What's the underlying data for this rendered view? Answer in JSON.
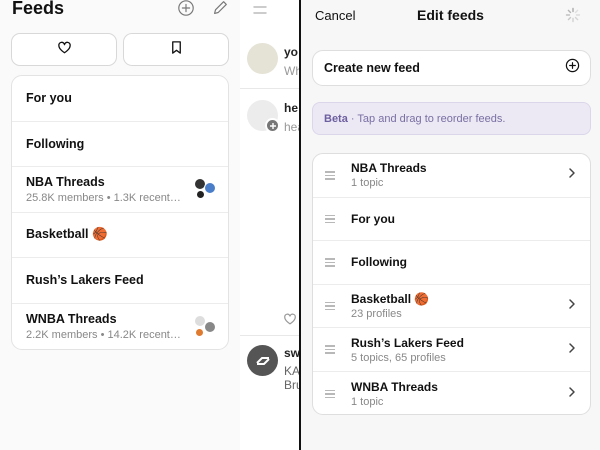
{
  "feeds_panel": {
    "title": "Feeds",
    "tabs": [
      {
        "icon": "heart-icon"
      },
      {
        "icon": "bookmark-icon"
      }
    ],
    "feeds": [
      {
        "name": "For you",
        "subtitle": ""
      },
      {
        "name": "Following",
        "subtitle": ""
      },
      {
        "name": "NBA Threads",
        "subtitle": "25.8K members • 1.3K recent…"
      },
      {
        "name": "Basketball 🏀",
        "subtitle": ""
      },
      {
        "name": "Rush’s Lakers Feed",
        "subtitle": ""
      },
      {
        "name": "WNBA Threads",
        "subtitle": "2.2K members • 14.2K recent…"
      }
    ]
  },
  "middle_panel": {
    "post1_name": "yo",
    "post1_text": "Wh",
    "post2_name": "he",
    "post2_text": "hea",
    "post3_name": "sw",
    "post3_line1": "KA",
    "post3_line2": "Bru"
  },
  "edit_feeds": {
    "cancel_label": "Cancel",
    "title": "Edit feeds",
    "create_label": "Create new feed",
    "beta_tag": "Beta",
    "beta_text": " · Tap and drag to reorder feeds.",
    "items": [
      {
        "name": "NBA Threads",
        "subtitle": "1 topic",
        "has_chevron": true
      },
      {
        "name": "For you",
        "subtitle": "",
        "has_chevron": false
      },
      {
        "name": "Following",
        "subtitle": "",
        "has_chevron": false
      },
      {
        "name": "Basketball 🏀",
        "subtitle": "23 profiles",
        "has_chevron": true
      },
      {
        "name": "Rush’s Lakers Feed",
        "subtitle": "5 topics, 65 profiles",
        "has_chevron": true
      },
      {
        "name": "WNBA Threads",
        "subtitle": "1 topic",
        "has_chevron": true
      }
    ]
  },
  "colors": {
    "beta_background": "#ede9f4",
    "beta_text": "#7a6fa3",
    "panel_background": "#f7f7f7"
  }
}
